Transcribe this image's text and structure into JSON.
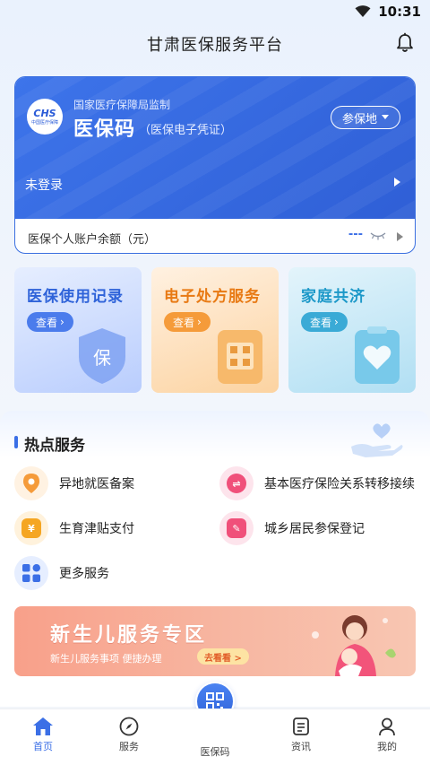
{
  "status_bar": {
    "time": "10:31"
  },
  "header": {
    "title": "甘肃医保服务平台"
  },
  "card": {
    "logo_text": "CHS",
    "logo_sub": "中国医疗保障",
    "supervise": "国家医疗保障局监制",
    "title": "医保码",
    "subtitle": "（医保电子凭证）",
    "region_label": "参保地",
    "login_text": "未登录",
    "balance_label": "医保个人账户余额（元）",
    "balance_value": "---"
  },
  "tiles": [
    {
      "title": "医保使用记录",
      "button": "查看"
    },
    {
      "title": "电子处方服务",
      "button": "查看"
    },
    {
      "title": "家庭共济",
      "button": "查看"
    }
  ],
  "hot_services": {
    "title": "热点服务",
    "items": [
      {
        "label": "异地就医备案",
        "icon": "location-pin-icon",
        "color": "#f59b3a"
      },
      {
        "label": "基本医疗保险关系转移接续",
        "icon": "transfer-icon",
        "color": "#f0507a"
      },
      {
        "label": "生育津贴支付",
        "icon": "yuan-wallet-icon",
        "color": "#f5a623"
      },
      {
        "label": "城乡居民参保登记",
        "icon": "register-icon",
        "color": "#f0507a"
      },
      {
        "label": "更多服务",
        "icon": "grid-icon",
        "color": "#3b6fe6"
      }
    ]
  },
  "banner": {
    "title": "新生儿服务专区",
    "subtitle": "新生儿服务事项 便捷办理",
    "button": "去看看 >"
  },
  "bottom_nav": {
    "items": [
      {
        "label": "首页",
        "icon": "home-icon"
      },
      {
        "label": "服务",
        "icon": "compass-icon"
      },
      {
        "label": "医保码",
        "icon": "qr-code-icon"
      },
      {
        "label": "资讯",
        "icon": "news-icon"
      },
      {
        "label": "我的",
        "icon": "user-icon"
      }
    ],
    "active_color": "#3b6fe6"
  }
}
